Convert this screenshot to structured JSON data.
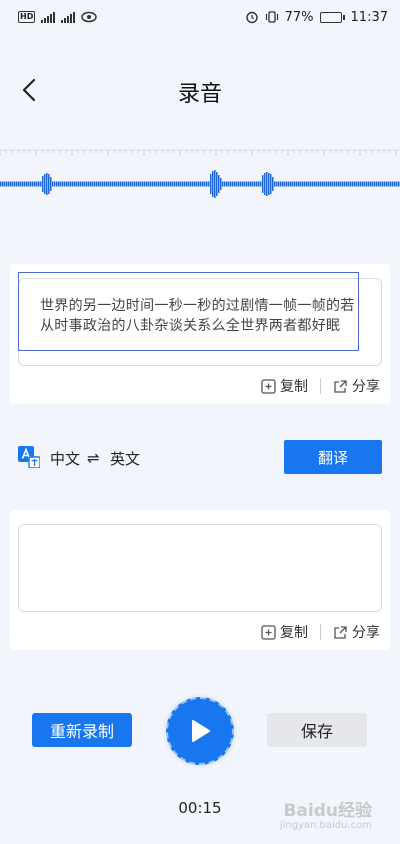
{
  "status_bar": {
    "hd": "HD",
    "net1": "4G",
    "net2": "4G",
    "battery_pct": "77%",
    "battery_level": 0.77,
    "time": "11:37"
  },
  "header": {
    "title": "录音"
  },
  "transcript": {
    "text": "世界的另一边时间一秒一秒的过剧情一帧一帧的若从时事政治的八卦杂谈关系么全世界两者都好眠"
  },
  "card_actions": {
    "copy": "复制",
    "share": "分享"
  },
  "translate": {
    "source_lang": "中文",
    "swap": "⇌",
    "target_lang": "英文",
    "button": "翻译"
  },
  "translation_output": {
    "text": ""
  },
  "controls": {
    "rerecord": "重新录制",
    "save": "保存",
    "elapsed": "00:15"
  },
  "watermark": {
    "text": "Baidu经验",
    "sub": "jingyan.baidu.com"
  },
  "colors": {
    "accent": "#1877ee",
    "background": "#f2f5fb"
  }
}
